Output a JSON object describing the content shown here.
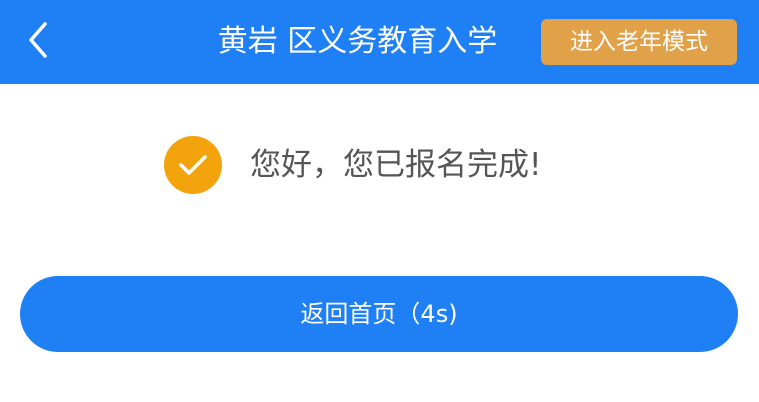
{
  "header": {
    "back_icon": "chevron-left-icon",
    "title": "黄岩 区义务教育入学",
    "elder_mode_label": "进入老年模式",
    "background_color": "#1f7ff5",
    "elder_button_color": "#e0a149"
  },
  "result": {
    "status_icon": "check-circle-icon",
    "icon_color": "#f3a30c",
    "message": "您好，您已报名完成!"
  },
  "actions": {
    "home_label": "返回首页（4s)",
    "button_color": "#1f7ff5"
  }
}
